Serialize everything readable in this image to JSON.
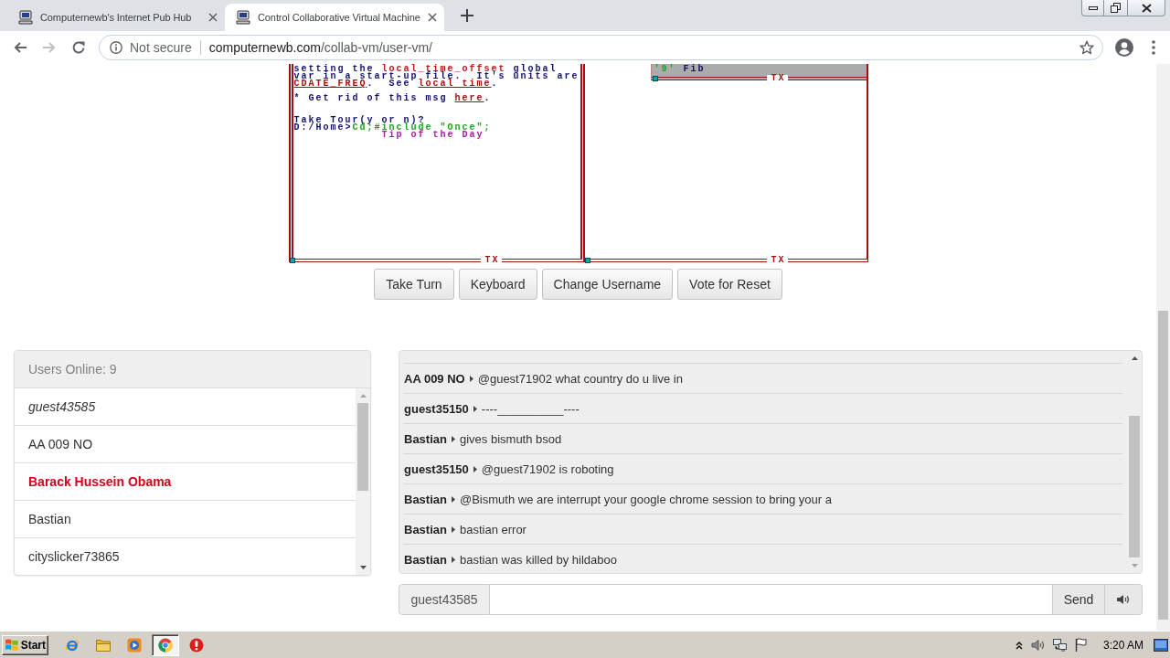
{
  "browser": {
    "tabs": [
      {
        "title": "Computernewb's Internet Pub Hub",
        "selected": false
      },
      {
        "title": "Control Collaborative Virtual Machine",
        "selected": true
      }
    ],
    "address_bar": {
      "security_label": "Not secure",
      "host": "computernewb.com",
      "path": "/collab-vm/user-vm/"
    }
  },
  "vm_screen": {
    "left_window": {
      "message": [
        {
          "segments": [
            {
              "kind": "plain",
              "text": "setting the "
            },
            {
              "kind": "term",
              "text": "local_time_offset"
            },
            {
              "kind": "plain",
              "text": " global"
            }
          ]
        },
        {
          "segments": [
            {
              "kind": "plain",
              "text": "var in a start-up file.  It's units are"
            }
          ]
        },
        {
          "segments": [
            {
              "kind": "link",
              "text": "CDATE_FREQ"
            },
            {
              "kind": "plain",
              "text": ".  See "
            },
            {
              "kind": "link",
              "text": "local time"
            },
            {
              "kind": "plain",
              "text": "."
            }
          ]
        }
      ],
      "note": [
        {
          "segments": [
            {
              "kind": "plain",
              "text": "* Get rid of this msg "
            },
            {
              "kind": "link",
              "text": "here"
            },
            {
              "kind": "plain",
              "text": "."
            }
          ]
        }
      ],
      "prompt": [
        {
          "segments": [
            {
              "kind": "plain",
              "text": "Take Tour(y or n)?"
            }
          ]
        },
        {
          "segments": [
            {
              "kind": "plain",
              "text": "D:/Home>"
            },
            {
              "kind": "command",
              "text": "Cd;#include \"Once\";"
            }
          ]
        }
      ],
      "tip": "Tip of the Day",
      "border_label": "TX"
    },
    "right_window": {
      "popup": {
        "key": "'9'",
        "label": "Fib",
        "border_label": "TX"
      },
      "border_label": "TX"
    }
  },
  "vm_buttons": [
    "Take Turn",
    "Keyboard",
    "Change Username",
    "Vote for Reset"
  ],
  "users_panel": {
    "title": "Users Online: 9",
    "users": [
      {
        "name": "guest43585",
        "kind": "self"
      },
      {
        "name": "AA 009 NO",
        "kind": "user"
      },
      {
        "name": "Barack Hussein Obama",
        "kind": "admin"
      },
      {
        "name": "Bastian",
        "kind": "user"
      },
      {
        "name": "cityslicker73865",
        "kind": "user"
      }
    ]
  },
  "chat": {
    "messages": [
      {
        "user": "AA 009 NO",
        "text": "@guest71902 what country do u live in"
      },
      {
        "user": "guest35150",
        "text": "----__________----"
      },
      {
        "user": "Bastian",
        "text": "gives bismuth bsod"
      },
      {
        "user": "guest35150",
        "text": "@guest71902 is roboting"
      },
      {
        "user": "Bastian",
        "text": "@Bismuth we are interrupt your google chrome session to bring your a"
      },
      {
        "user": "Bastian",
        "text": "bastian error"
      },
      {
        "user": "Bastian",
        "text": "bastian was killed by hildaboo"
      }
    ],
    "input": {
      "username": "guest43585",
      "send_label": "Send"
    }
  },
  "taskbar": {
    "start_label": "Start",
    "pinned": [
      {
        "selected": false
      },
      {
        "selected": false
      },
      {
        "selected": false
      },
      {
        "selected": true
      },
      {
        "selected": false
      }
    ],
    "clock": "3:20 AM"
  }
}
